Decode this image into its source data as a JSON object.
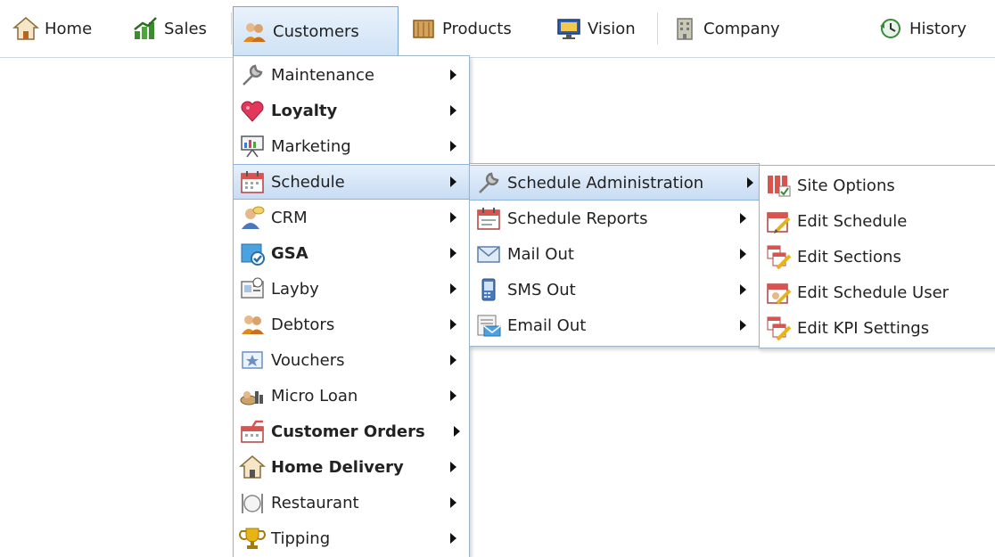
{
  "navbar": {
    "items": [
      {
        "label": "Home",
        "icon": "home-icon"
      },
      {
        "label": "Sales",
        "icon": "sales-chart-icon"
      },
      {
        "label": "Customers",
        "icon": "customers-icon",
        "active": true
      },
      {
        "label": "Products",
        "icon": "products-icon"
      },
      {
        "label": "Vision",
        "icon": "vision-monitor-icon"
      },
      {
        "label": "Company",
        "icon": "company-building-icon"
      },
      {
        "label": "History",
        "icon": "history-icon"
      }
    ]
  },
  "customers_menu": {
    "items": [
      {
        "label": "Maintenance",
        "icon": "wrench-icon",
        "bold": false
      },
      {
        "label": "Loyalty",
        "icon": "heart-icon",
        "bold": true
      },
      {
        "label": "Marketing",
        "icon": "presentation-board-icon",
        "bold": false
      },
      {
        "label": "Schedule",
        "icon": "calendar-icon",
        "bold": false,
        "highlighted": true
      },
      {
        "label": "CRM",
        "icon": "crm-person-icon",
        "bold": false
      },
      {
        "label": "GSA",
        "icon": "gsa-icon",
        "bold": true
      },
      {
        "label": "Layby",
        "icon": "layby-icon",
        "bold": false
      },
      {
        "label": "Debtors",
        "icon": "debtors-icon",
        "bold": false
      },
      {
        "label": "Vouchers",
        "icon": "voucher-icon",
        "bold": false
      },
      {
        "label": "Micro Loan",
        "icon": "micro-loan-icon",
        "bold": false
      },
      {
        "label": "Customer Orders",
        "icon": "customer-orders-icon",
        "bold": true
      },
      {
        "label": "Home Delivery",
        "icon": "home-delivery-icon",
        "bold": true
      },
      {
        "label": "Restaurant",
        "icon": "restaurant-icon",
        "bold": false
      },
      {
        "label": "Tipping",
        "icon": "trophy-icon",
        "bold": false
      }
    ]
  },
  "schedule_menu": {
    "items": [
      {
        "label": "Schedule Administration",
        "icon": "wrench-icon",
        "highlighted": true
      },
      {
        "label": "Schedule Reports",
        "icon": "calendar-report-icon"
      },
      {
        "label": "Mail Out",
        "icon": "mail-icon"
      },
      {
        "label": "SMS Out",
        "icon": "phone-icon"
      },
      {
        "label": "Email Out",
        "icon": "email-icon"
      }
    ]
  },
  "admin_menu": {
    "items": [
      {
        "label": "Site Options",
        "icon": "site-options-icon"
      },
      {
        "label": "Edit Schedule",
        "icon": "edit-calendar-icon"
      },
      {
        "label": "Edit Sections",
        "icon": "edit-sections-icon"
      },
      {
        "label": "Edit Schedule User",
        "icon": "edit-schedule-user-icon"
      },
      {
        "label": "Edit KPI Settings",
        "icon": "edit-kpi-icon"
      }
    ]
  },
  "colors": {
    "highlight_top": "#e6f0fb",
    "highlight_bottom": "#c8dcf3",
    "menu_border": "#9fb4c8"
  }
}
